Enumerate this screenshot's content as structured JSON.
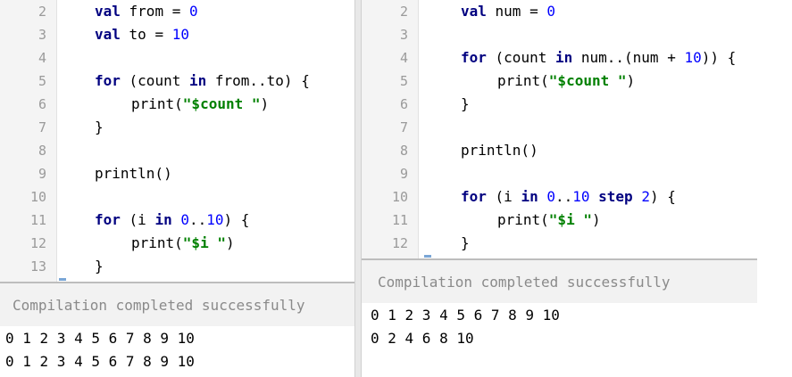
{
  "left": {
    "lines": [
      {
        "n": "2",
        "code": "val from = 0"
      },
      {
        "n": "3",
        "code": "val to = 10"
      },
      {
        "n": "4",
        "code": ""
      },
      {
        "n": "5",
        "code": "for (count in from..to) {"
      },
      {
        "n": "6",
        "code": "print(\"$count \")"
      },
      {
        "n": "7",
        "code": "}"
      },
      {
        "n": "8",
        "code": ""
      },
      {
        "n": "9",
        "code": "println()"
      },
      {
        "n": "10",
        "code": ""
      },
      {
        "n": "11",
        "code": "for (i in 0..10) {"
      },
      {
        "n": "12",
        "code": "print(\"$i \")"
      },
      {
        "n": "13",
        "code": "}"
      }
    ],
    "status": "Compilation completed successfully",
    "output": [
      "0 1 2 3 4 5 6 7 8 9 10",
      "0 1 2 3 4 5 6 7 8 9 10"
    ]
  },
  "right": {
    "lines": [
      {
        "n": "2",
        "code": "val num = 0"
      },
      {
        "n": "3",
        "code": ""
      },
      {
        "n": "4",
        "code": "for (count in num..(num + 10)) {"
      },
      {
        "n": "5",
        "code": "print(\"$count \")"
      },
      {
        "n": "6",
        "code": "}"
      },
      {
        "n": "7",
        "code": ""
      },
      {
        "n": "8",
        "code": "println()"
      },
      {
        "n": "9",
        "code": ""
      },
      {
        "n": "10",
        "code": "for (i in 0..10 step 2) {"
      },
      {
        "n": "11",
        "code": "print(\"$i \")"
      },
      {
        "n": "12",
        "code": "}"
      }
    ],
    "status": "Compilation completed successfully",
    "output": [
      "0 1 2 3 4 5 6 7 8 9 10",
      "0 2 4 6 8 10"
    ]
  }
}
